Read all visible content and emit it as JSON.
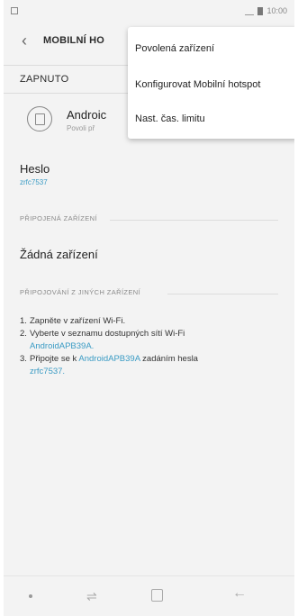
{
  "status_bar": {
    "time": "10:00"
  },
  "appbar": {
    "title": "MOBILNÍ HO"
  },
  "hotspot_toggle": {
    "label": "ZAPNUTO"
  },
  "network": {
    "name": "Androic",
    "subtitle": "Povoli př"
  },
  "password": {
    "label": "Heslo",
    "value": "zrfc7537"
  },
  "sections": {
    "connected": "PŘIPOJENÁ ZAŘÍZENÍ",
    "other": "PŘIPOJOVÁNÍ Z JINÝCH ZAŘÍZENÍ"
  },
  "no_devices": "Žádná zařízení",
  "steps": {
    "s1_num": "1.",
    "s1": "Zapněte v zařízení Wi-Fi.",
    "s2_num": "2.",
    "s2a": "Vyberte v seznamu dostupných sítí Wi-Fi",
    "s2_link": "AndroidAPB39A.",
    "s3_num": "3.",
    "s3a": "Připojte se k ",
    "s3_link": "AndroidAPB39A",
    "s3b": " zadáním hesla",
    "s3_link2": "zrfc7537."
  },
  "menu": {
    "item1": "Povolená zařízení",
    "item2": "Konfigurovat Mobilní hotspot",
    "item3": "Nast. čas. limitu"
  },
  "colors": {
    "accent": "#3a9bc4",
    "background": "#f3f3f3"
  }
}
